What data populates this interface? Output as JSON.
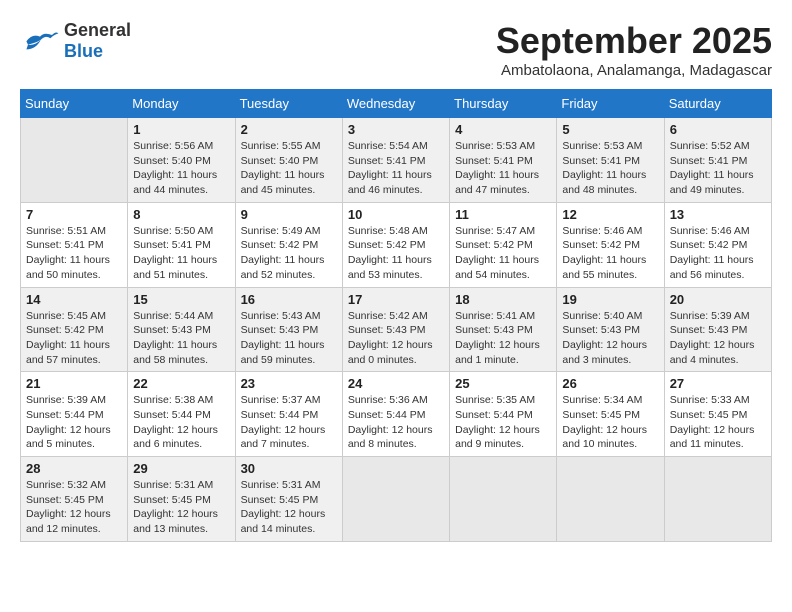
{
  "logo": {
    "general": "General",
    "blue": "Blue"
  },
  "title": "September 2025",
  "subtitle": "Ambatolaona, Analamanga, Madagascar",
  "days_of_week": [
    "Sunday",
    "Monday",
    "Tuesday",
    "Wednesday",
    "Thursday",
    "Friday",
    "Saturday"
  ],
  "weeks": [
    [
      {
        "day": "",
        "info": ""
      },
      {
        "day": "1",
        "info": "Sunrise: 5:56 AM\nSunset: 5:40 PM\nDaylight: 11 hours\nand 44 minutes."
      },
      {
        "day": "2",
        "info": "Sunrise: 5:55 AM\nSunset: 5:40 PM\nDaylight: 11 hours\nand 45 minutes."
      },
      {
        "day": "3",
        "info": "Sunrise: 5:54 AM\nSunset: 5:41 PM\nDaylight: 11 hours\nand 46 minutes."
      },
      {
        "day": "4",
        "info": "Sunrise: 5:53 AM\nSunset: 5:41 PM\nDaylight: 11 hours\nand 47 minutes."
      },
      {
        "day": "5",
        "info": "Sunrise: 5:53 AM\nSunset: 5:41 PM\nDaylight: 11 hours\nand 48 minutes."
      },
      {
        "day": "6",
        "info": "Sunrise: 5:52 AM\nSunset: 5:41 PM\nDaylight: 11 hours\nand 49 minutes."
      }
    ],
    [
      {
        "day": "7",
        "info": "Sunrise: 5:51 AM\nSunset: 5:41 PM\nDaylight: 11 hours\nand 50 minutes."
      },
      {
        "day": "8",
        "info": "Sunrise: 5:50 AM\nSunset: 5:41 PM\nDaylight: 11 hours\nand 51 minutes."
      },
      {
        "day": "9",
        "info": "Sunrise: 5:49 AM\nSunset: 5:42 PM\nDaylight: 11 hours\nand 52 minutes."
      },
      {
        "day": "10",
        "info": "Sunrise: 5:48 AM\nSunset: 5:42 PM\nDaylight: 11 hours\nand 53 minutes."
      },
      {
        "day": "11",
        "info": "Sunrise: 5:47 AM\nSunset: 5:42 PM\nDaylight: 11 hours\nand 54 minutes."
      },
      {
        "day": "12",
        "info": "Sunrise: 5:46 AM\nSunset: 5:42 PM\nDaylight: 11 hours\nand 55 minutes."
      },
      {
        "day": "13",
        "info": "Sunrise: 5:46 AM\nSunset: 5:42 PM\nDaylight: 11 hours\nand 56 minutes."
      }
    ],
    [
      {
        "day": "14",
        "info": "Sunrise: 5:45 AM\nSunset: 5:42 PM\nDaylight: 11 hours\nand 57 minutes."
      },
      {
        "day": "15",
        "info": "Sunrise: 5:44 AM\nSunset: 5:43 PM\nDaylight: 11 hours\nand 58 minutes."
      },
      {
        "day": "16",
        "info": "Sunrise: 5:43 AM\nSunset: 5:43 PM\nDaylight: 11 hours\nand 59 minutes."
      },
      {
        "day": "17",
        "info": "Sunrise: 5:42 AM\nSunset: 5:43 PM\nDaylight: 12 hours\nand 0 minutes."
      },
      {
        "day": "18",
        "info": "Sunrise: 5:41 AM\nSunset: 5:43 PM\nDaylight: 12 hours\nand 1 minute."
      },
      {
        "day": "19",
        "info": "Sunrise: 5:40 AM\nSunset: 5:43 PM\nDaylight: 12 hours\nand 3 minutes."
      },
      {
        "day": "20",
        "info": "Sunrise: 5:39 AM\nSunset: 5:43 PM\nDaylight: 12 hours\nand 4 minutes."
      }
    ],
    [
      {
        "day": "21",
        "info": "Sunrise: 5:39 AM\nSunset: 5:44 PM\nDaylight: 12 hours\nand 5 minutes."
      },
      {
        "day": "22",
        "info": "Sunrise: 5:38 AM\nSunset: 5:44 PM\nDaylight: 12 hours\nand 6 minutes."
      },
      {
        "day": "23",
        "info": "Sunrise: 5:37 AM\nSunset: 5:44 PM\nDaylight: 12 hours\nand 7 minutes."
      },
      {
        "day": "24",
        "info": "Sunrise: 5:36 AM\nSunset: 5:44 PM\nDaylight: 12 hours\nand 8 minutes."
      },
      {
        "day": "25",
        "info": "Sunrise: 5:35 AM\nSunset: 5:44 PM\nDaylight: 12 hours\nand 9 minutes."
      },
      {
        "day": "26",
        "info": "Sunrise: 5:34 AM\nSunset: 5:45 PM\nDaylight: 12 hours\nand 10 minutes."
      },
      {
        "day": "27",
        "info": "Sunrise: 5:33 AM\nSunset: 5:45 PM\nDaylight: 12 hours\nand 11 minutes."
      }
    ],
    [
      {
        "day": "28",
        "info": "Sunrise: 5:32 AM\nSunset: 5:45 PM\nDaylight: 12 hours\nand 12 minutes."
      },
      {
        "day": "29",
        "info": "Sunrise: 5:31 AM\nSunset: 5:45 PM\nDaylight: 12 hours\nand 13 minutes."
      },
      {
        "day": "30",
        "info": "Sunrise: 5:31 AM\nSunset: 5:45 PM\nDaylight: 12 hours\nand 14 minutes."
      },
      {
        "day": "",
        "info": ""
      },
      {
        "day": "",
        "info": ""
      },
      {
        "day": "",
        "info": ""
      },
      {
        "day": "",
        "info": ""
      }
    ]
  ]
}
